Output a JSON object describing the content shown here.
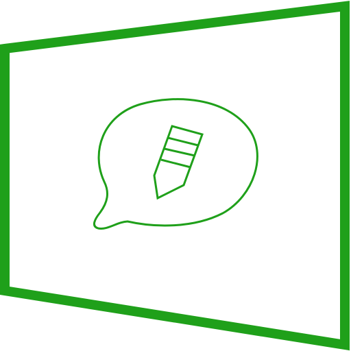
{
  "icon": {
    "name": "feedback-app-icon",
    "frame_glyph": "slanted-window-frame-icon",
    "bubble_glyph": "speech-bubble-icon",
    "pencil_glyph": "pencil-icon",
    "stroke_color": "#1fa01a",
    "background_color": "#ffffff"
  }
}
